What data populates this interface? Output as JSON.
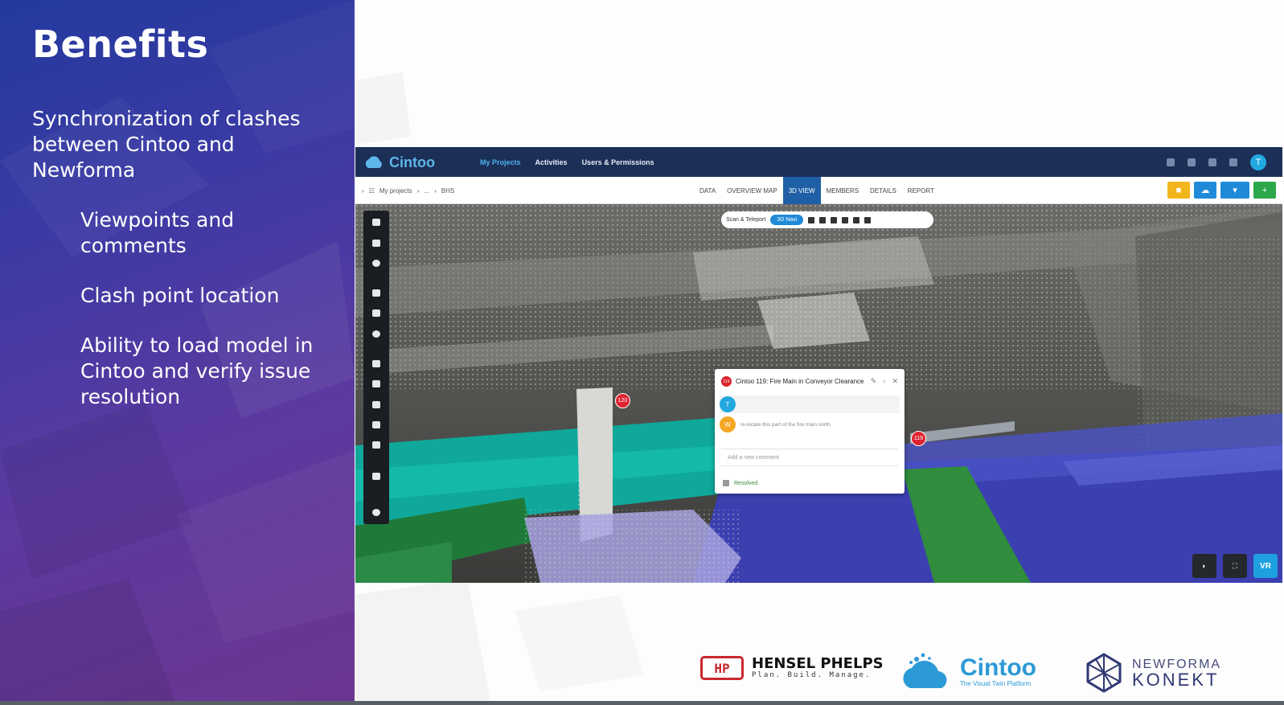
{
  "slide": {
    "title": "Benefits",
    "lead": "Synchronization of clashes between Cintoo and Newforma",
    "bullets": [
      "Viewpoints and comments",
      "Clash point location",
      "Ability to load model in Cintoo and verify issue resolution"
    ]
  },
  "app": {
    "logo_text": "Cintoo",
    "nav": [
      "My Projects",
      "Activities",
      "Users & Permissions"
    ],
    "avatar_initial": "T",
    "breadcrumb": [
      "My projects",
      "...",
      "BHS"
    ],
    "tabs": [
      "DATA",
      "OVERVIEW MAP",
      "3D VIEW",
      "MEMBERS",
      "DETAILS",
      "REPORT"
    ],
    "active_tab": "3D VIEW",
    "toolbar": {
      "mode_label": "Scan & Teleport",
      "toggle_label": "3D Navi"
    },
    "comment": {
      "badge": "119",
      "title": "Cintoo 119: Fire Main in Conveyor Clearance",
      "rows": [
        {
          "initial": "T",
          "text": ""
        },
        {
          "initial": "W",
          "text": "re-locate this part of the fire main north"
        }
      ],
      "input_placeholder": "Add a new comment",
      "resolved_label": "Resolved"
    },
    "markers": [
      "120",
      "119"
    ],
    "vr_label": "VR"
  },
  "logos": {
    "hensel_mark": "HP",
    "hensel_name": "HENSEL PHELPS",
    "hensel_tag": "Plan. Build. Manage.",
    "cintoo_name": "Cintoo",
    "cintoo_tag": "The Visual Twin Platform",
    "newforma_line1": "NEWFORMA",
    "newforma_line2": "KONEKT"
  },
  "colors": {
    "slide_gradient_start": "#233a9e",
    "slide_gradient_end": "#6b3591",
    "app_topbar": "#1b2f57",
    "active_tab": "#1f5fa6",
    "marker_red": "#e02330",
    "cintoo_blue": "#2c9ad6"
  }
}
